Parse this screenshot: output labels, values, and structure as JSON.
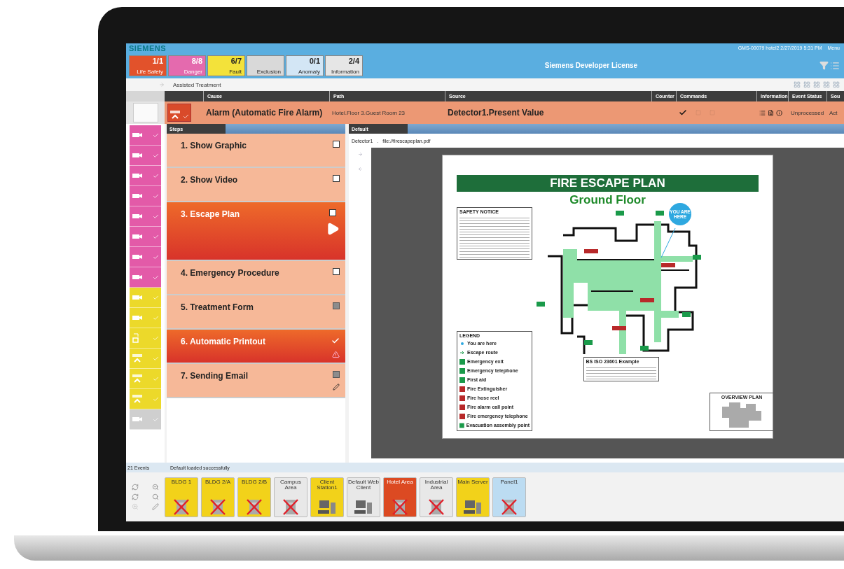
{
  "header": {
    "brand": "SIEMENS",
    "info": "GMS-00079   hotel2   2/27/2019 5:31 PM",
    "menu": "Menu",
    "license": "Siemens Developer License"
  },
  "summary": [
    {
      "count": "1/1",
      "label": "Life Safety",
      "color": "#e2522b"
    },
    {
      "count": "8/8",
      "label": "Danger",
      "color": "#e46aae"
    },
    {
      "count": "6/7",
      "label": "Fault",
      "color": "#f3e23a"
    },
    {
      "label": "Exclusion",
      "color": "#d9d9d9"
    },
    {
      "count": "0/1",
      "label": "Anomaly",
      "color": "#d3e6f5"
    },
    {
      "count": "2/4",
      "label": "Information",
      "color": "#e6e6e6"
    }
  ],
  "toolbar": {
    "title": "Assisted Treatment"
  },
  "columns": [
    "Cause",
    "Path",
    "Source",
    "Counter",
    "Commands",
    "Information",
    "Event Status",
    "Sou"
  ],
  "event": {
    "cause": "Alarm (Automatic Fire Alarm)",
    "path": "Hotel.Floor 3.Guest Room 23",
    "source": "Detector1.Present Value",
    "status": "Unprocessed",
    "column_9": "Act"
  },
  "event_list": [
    {
      "kind": "camera",
      "color": "#e35aa8"
    },
    {
      "kind": "camera",
      "color": "#e35aa8"
    },
    {
      "kind": "camera",
      "color": "#e35aa8"
    },
    {
      "kind": "camera",
      "color": "#e35aa8"
    },
    {
      "kind": "camera",
      "color": "#e35aa8"
    },
    {
      "kind": "camera",
      "color": "#e35aa8"
    },
    {
      "kind": "camera",
      "color": "#e35aa8"
    },
    {
      "kind": "camera",
      "color": "#e35aa8"
    },
    {
      "kind": "camera",
      "color": "#ecd92a"
    },
    {
      "kind": "camera",
      "color": "#ecd92a"
    },
    {
      "kind": "module",
      "color": "#ecd92a"
    },
    {
      "kind": "detector",
      "color": "#ecd92a"
    },
    {
      "kind": "detector",
      "color": "#ecd92a"
    },
    {
      "kind": "detector",
      "color": "#ecd92a"
    },
    {
      "kind": "camera",
      "color": "#cfcfcf"
    }
  ],
  "steps_panel": {
    "title": "Steps"
  },
  "steps": [
    {
      "label": "1. Show Graphic",
      "checked": false,
      "disabled": false,
      "active": false,
      "selected": false,
      "warning": false,
      "editable": false
    },
    {
      "label": "2. Show Video",
      "checked": false,
      "disabled": false,
      "active": false,
      "selected": false,
      "warning": false,
      "editable": false
    },
    {
      "label": "3. Escape Plan",
      "checked": false,
      "disabled": false,
      "active": true,
      "selected": true,
      "warning": false,
      "editable": false
    },
    {
      "label": "4. Emergency Procedure",
      "checked": false,
      "disabled": false,
      "active": false,
      "selected": false,
      "warning": false,
      "editable": false
    },
    {
      "label": "5. Treatment Form",
      "checked": false,
      "disabled": true,
      "active": false,
      "selected": false,
      "warning": false,
      "editable": false
    },
    {
      "label": "6. Automatic Printout",
      "checked": true,
      "disabled": false,
      "active": true,
      "selected": false,
      "warning": true,
      "editable": false
    },
    {
      "label": "7. Sending Email",
      "checked": false,
      "disabled": true,
      "active": false,
      "selected": false,
      "warning": false,
      "editable": true
    }
  ],
  "viewer": {
    "tab": "Default",
    "object": "Detector1",
    "separator": ".",
    "file": "file://firescapeplan.pdf"
  },
  "plan": {
    "title": "FIRE ESCAPE PLAN",
    "subtitle": "Ground Floor",
    "marker": "YOU ARE HERE",
    "notice_title": "SAFETY NOTICE",
    "legend_title": "LEGEND",
    "legend": [
      {
        "kind": "dot",
        "label": "You are here"
      },
      {
        "kind": "arrow",
        "label": "Escape route"
      },
      {
        "kind": "exit",
        "label": "Emergency exit"
      },
      {
        "kind": "phone",
        "label": "Emergency telephone"
      },
      {
        "kind": "aid",
        "label": "First aid"
      },
      {
        "kind": "fire",
        "label": "Fire Extinguisher"
      },
      {
        "kind": "fire",
        "label": "Fire hose reel"
      },
      {
        "kind": "fire",
        "label": "Fire alarm call point"
      },
      {
        "kind": "fire",
        "label": "Fire emergency telephone"
      },
      {
        "kind": "assembly",
        "label": "Evacuation assembly point"
      }
    ],
    "block_title": "BS ISO 23601 Example",
    "overview_title": "OVERVIEW PLAN"
  },
  "status_bar": {
    "events": "21 Events",
    "message": "Default loaded successfully"
  },
  "nodes": [
    {
      "label": "BLDG 1",
      "kind": "building",
      "color": "#f2d21a",
      "error": true
    },
    {
      "label": "BLDG 2/A",
      "kind": "building",
      "color": "#f2d21a",
      "error": true
    },
    {
      "label": "BLDG 2/B",
      "kind": "building",
      "color": "#f2d21a",
      "error": true
    },
    {
      "label": "Campus Area",
      "kind": "building",
      "color": "#e8e8e8",
      "error": true
    },
    {
      "label": "Client Station1",
      "kind": "computer",
      "color": "#f2d21a",
      "error": false
    },
    {
      "label": "Default Web Client",
      "kind": "computer",
      "color": "#e8e8e8",
      "error": false
    },
    {
      "label": "Hotel Area",
      "kind": "building",
      "color": "#dc4a22",
      "error": true
    },
    {
      "label": "Industrial Area",
      "kind": "building",
      "color": "#e8e8e8",
      "error": true
    },
    {
      "label": "Main Server",
      "kind": "computer",
      "color": "#f2d21a",
      "error": false
    },
    {
      "label": "Panel1",
      "kind": "building",
      "color": "#bcdcf2",
      "error": true
    }
  ]
}
